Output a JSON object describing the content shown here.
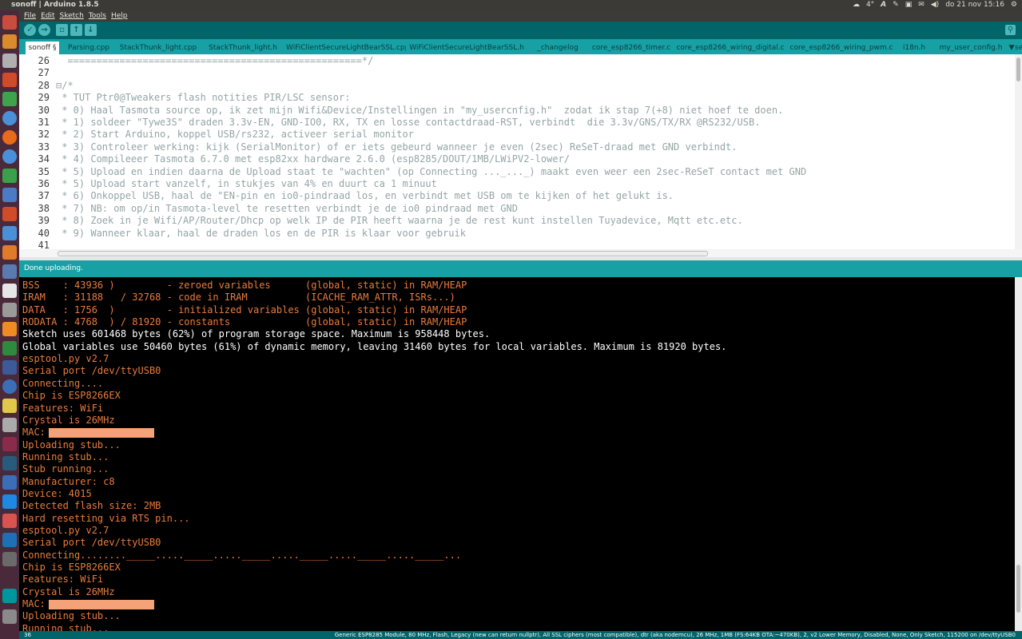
{
  "window": {
    "title": "sonoff | Arduino 1.8.5"
  },
  "tray": {
    "weather": "4°",
    "text_icon": "A",
    "datetime": "do 21 nov 15:16"
  },
  "menu": [
    "File",
    "Edit",
    "Sketch",
    "Tools",
    "Help"
  ],
  "tabs": [
    "sonoff §",
    "Parsing.cpp",
    "StackThunk_light.cpp",
    "StackThunk_light.h",
    "WiFiClientSecureLightBearSSL.cpp",
    "WiFiClientSecureLightBearSSL.h",
    "_changelog",
    "core_esp8266_timer.c",
    "core_esp8266_wiring_digital.c",
    "core_esp8266_wiring_pwm.c",
    "i18n.h",
    "my_user_config.h",
    "se"
  ],
  "tab_dropdown": "▼",
  "editor": {
    "lines": [
      {
        "n": "26",
        "t": "  ===================================================*/"
      },
      {
        "n": "27",
        "t": ""
      },
      {
        "n": "28",
        "t": "⊟/*"
      },
      {
        "n": "29",
        "t": " * TUT Ptr0@Tweakers flash notities PIR/LSC sensor:"
      },
      {
        "n": "30",
        "t": " * 0) Haal Tasmota source op, ik zet mijn Wifi&Device/Instellingen in \"my_usercnfig.h\"  zodat ik stap 7(+8) niet hoef te doen."
      },
      {
        "n": "31",
        "t": " * 1) soldeer \"Tywe3S\" draden 3.3v-EN, GND-IO0, RX, TX en losse contactdraad-RST, verbindt  die 3.3v/GNS/TX/RX @RS232/USB."
      },
      {
        "n": "32",
        "t": " * 2) Start Arduino, koppel USB/rs232, activeer serial monitor"
      },
      {
        "n": "33",
        "t": " * 3) Controleer werking: kijk (SerialMonitor) of er iets gebeurd wanneer je even (2sec) ReSeT-draad met GND verbindt."
      },
      {
        "n": "34",
        "t": " * 4) Compileeer Tasmota 6.7.0 met esp82xx hardware 2.6.0 (esp8285/DOUT/1MB/LWiPV2-lower/"
      },
      {
        "n": "35",
        "t": " * 5) Upload en indien daarna de Upload staat te \"wachten\" (op Connecting ..._..._) maakt even weer een 2sec-ReSeT contact met GND"
      },
      {
        "n": "36",
        "t": " * 5) Upload start vanzelf, in stukjes van 4% en duurt ca 1 minuut"
      },
      {
        "n": "37",
        "t": " * 6) Onkoppel USB, haal de \"EN-pin en io0-pindraad los, en verbindt met USB om te kijken of het gelukt is."
      },
      {
        "n": "38",
        "t": " * 7) NB: om op/in Tasmota-level te resetten verbindt je de io0 pindraad met GND"
      },
      {
        "n": "39",
        "t": " * 8) Zoek in je Wifi/AP/Router/Dhcp op welk IP de PIR heeft waarna je de rest kunt instellen Tuyadevice, Mqtt etc.etc."
      },
      {
        "n": "40",
        "t": " * 9) Wanneer klaar, haal de draden los en de PIR is klaar voor gebruik"
      },
      {
        "n": "41",
        "t": ""
      }
    ]
  },
  "status": {
    "message": "Done uploading."
  },
  "console": {
    "lines": [
      {
        "t": "BSS    : 43936 )         - zeroed variables      (global, static) in RAM/HEAP",
        "c": "orange"
      },
      {
        "t": "IRAM   : 31188   / 32768 - code in IRAM          (ICACHE_RAM_ATTR, ISRs...)",
        "c": "orange"
      },
      {
        "t": "DATA   : 1756  )         - initialized variables (global, static) in RAM/HEAP",
        "c": "orange"
      },
      {
        "t": "RODATA : 4768  ) / 81920 - constants             (global, static) in RAM/HEAP",
        "c": "orange"
      },
      {
        "t": "Sketch uses 601468 bytes (62%) of program storage space. Maximum is 958448 bytes.",
        "c": "white"
      },
      {
        "t": "Global variables use 50460 bytes (61%) of dynamic memory, leaving 31460 bytes for local variables. Maximum is 81920 bytes.",
        "c": "white"
      },
      {
        "t": "esptool.py v2.7",
        "c": "orange"
      },
      {
        "t": "Serial port /dev/ttyUSB0",
        "c": "orange"
      },
      {
        "t": "Connecting....",
        "c": "orange"
      },
      {
        "t": "Chip is ESP8266EX",
        "c": "orange"
      },
      {
        "t": "Features: WiFi",
        "c": "orange"
      },
      {
        "t": "Crystal is 26MHz",
        "c": "orange"
      },
      {
        "t": "MAC:",
        "c": "orange",
        "redacted": true
      },
      {
        "t": "Uploading stub...",
        "c": "orange"
      },
      {
        "t": "Running stub...",
        "c": "orange"
      },
      {
        "t": "Stub running...",
        "c": "orange"
      },
      {
        "t": "Manufacturer: c8",
        "c": "orange"
      },
      {
        "t": "Device: 4015",
        "c": "orange"
      },
      {
        "t": "Detected flash size: 2MB",
        "c": "orange"
      },
      {
        "t": "Hard resetting via RTS pin...",
        "c": "orange"
      },
      {
        "t": "esptool.py v2.7",
        "c": "orange"
      },
      {
        "t": "Serial port /dev/ttyUSB0",
        "c": "orange"
      },
      {
        "t": "Connecting........_____....._____....._____....._____....._____....._____...",
        "c": "orange"
      },
      {
        "t": "Chip is ESP8266EX",
        "c": "orange"
      },
      {
        "t": "Features: WiFi",
        "c": "orange"
      },
      {
        "t": "Crystal is 26MHz",
        "c": "orange"
      },
      {
        "t": "MAC:",
        "c": "orange",
        "redacted": true
      },
      {
        "t": "Uploading stub...",
        "c": "orange"
      },
      {
        "t": "Running stub...",
        "c": "orange"
      }
    ]
  },
  "footer": {
    "line": "36",
    "board": "Generic ESP8285 Module, 80 MHz, Flash, Legacy (new can return nullptr), All SSL ciphers (most compatible), dtr (aka nodemcu), 26 MHz, 1MB (FS:64KB OTA:~470KB), 2, v2 Lower Memory, Disabled, None, Only Sketch, 115200 on /dev/ttyUSB0"
  },
  "colors": {
    "toolbar": "#006468",
    "tabbar": "#17a1a5",
    "console_text": "#e97b3d",
    "launcher": "#4a2a3a"
  }
}
